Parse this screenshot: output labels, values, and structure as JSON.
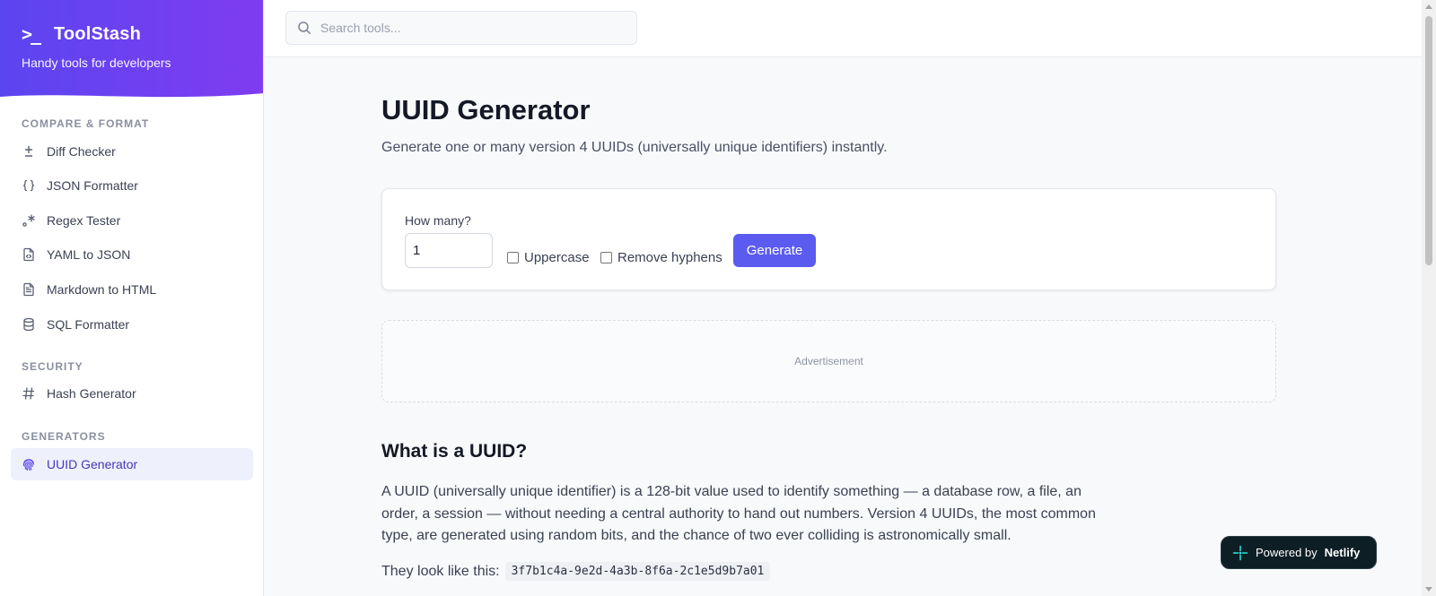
{
  "brand": {
    "logo": ">_",
    "name": "ToolStash",
    "tagline": "Handy tools for developers"
  },
  "sidebar": {
    "sections": [
      {
        "title": "COMPARE & FORMAT"
      },
      {
        "title": "SECURITY"
      },
      {
        "title": "GENERATORS"
      }
    ],
    "items": [
      {
        "label": "Diff Checker",
        "icon": "plus-minus-icon"
      },
      {
        "label": "JSON Formatter",
        "icon": "braces-icon"
      },
      {
        "label": "Regex Tester",
        "icon": "regex-icon"
      },
      {
        "label": "YAML to JSON",
        "icon": "file-code-icon"
      },
      {
        "label": "Markdown to HTML",
        "icon": "file-text-icon"
      },
      {
        "label": "SQL Formatter",
        "icon": "database-icon"
      },
      {
        "label": "Hash Generator",
        "icon": "hash-icon"
      },
      {
        "label": "UUID Generator",
        "icon": "fingerprint-icon",
        "active": true
      }
    ]
  },
  "search": {
    "placeholder": "Search tools..."
  },
  "main": {
    "title": "UUID Generator",
    "subtitle": "Generate one or many version 4 UUIDs (universally unique identifiers) instantly.",
    "form": {
      "how_many_label": "How many?",
      "how_many_value": "1",
      "uppercase_label": "Uppercase",
      "remove_hyphens_label": "Remove hyphens",
      "generate_label": "Generate"
    },
    "ad_label": "Advertisement",
    "what_heading": "What is a UUID?",
    "what_paragraph": "A UUID (universally unique identifier) is a 128-bit value used to identify something — a database row, a file, an order, a session — without needing a central authority to hand out numbers. Version 4 UUIDs, the most common type, are generated using random bits, and the chance of two ever colliding is astronomically small.",
    "example_prefix": "They look like this:",
    "example_uuid": "3f7b1c4a-9e2d-4a3b-8f6a-2c1e5d9b7a01"
  },
  "netlify": {
    "prefix": "Powered by",
    "name": "Netlify"
  },
  "colors": {
    "accent": "#5b5bf0",
    "brand_start": "#5b45f0",
    "brand_end": "#7f3cf0"
  }
}
